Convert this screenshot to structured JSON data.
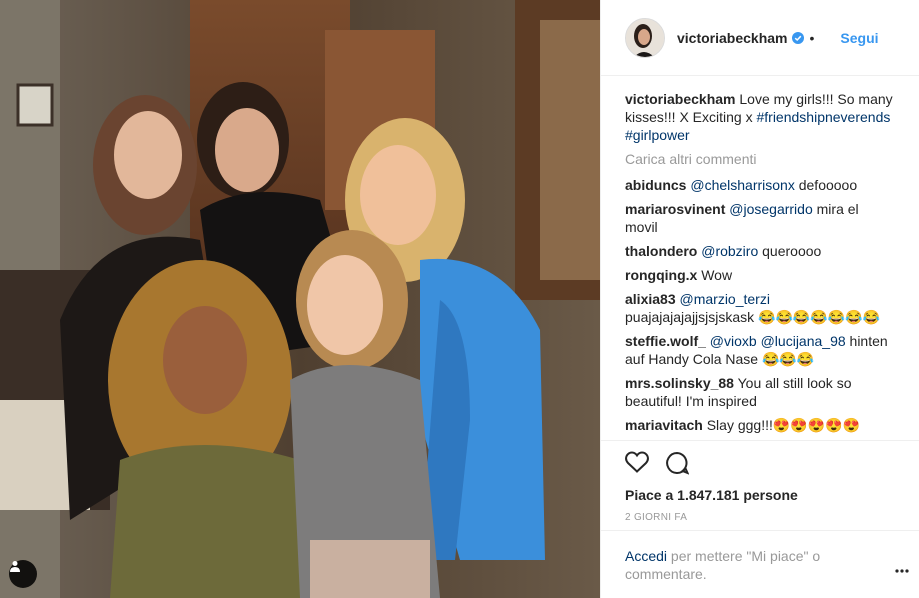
{
  "header": {
    "username": "victoriabeckham",
    "dot": "•",
    "follow_label": "Segui"
  },
  "caption": {
    "username": "victoriabeckham",
    "text": " Love my girls!!! So many kisses!!! X Exciting x ",
    "hashtags": [
      "#friendshipneverends",
      "#girlpower"
    ]
  },
  "load_more_label": "Carica altri commenti",
  "comments": [
    {
      "user": "abiduncs",
      "mentions": [
        "@chelsharrisonx"
      ],
      "text": " defooooo"
    },
    {
      "user": "mariarosvinent",
      "mentions": [
        "@josegarrido"
      ],
      "text": " mira el movil"
    },
    {
      "user": "thalondero",
      "mentions": [
        "@robziro"
      ],
      "text": " queroooo"
    },
    {
      "user": "rongqing.x",
      "mentions": [],
      "text": " Wow"
    },
    {
      "user": "alixia83",
      "mentions": [
        "@marzio_terzi"
      ],
      "text": " puajajajajajjsjsjskask 😂😂😂😂😂😂😂"
    },
    {
      "user": "steffie.wolf_",
      "mentions": [
        "@vioxb",
        "@lucijana_98"
      ],
      "text": " hinten auf Handy Cola Nase 😂😂😂"
    },
    {
      "user": "mrs.solinsky_88",
      "mentions": [],
      "text": " You all still look so beautiful! I'm inspired"
    },
    {
      "user": "mariavitach",
      "mentions": [],
      "text": " Slay ggg!!!😍😍😍😍😍"
    }
  ],
  "likes_text": "Piace a 1.847.181 persone",
  "date_text": "2 GIORNI FA",
  "login": {
    "link": "Accedi",
    "text": " per mettere \"Mi piace\" o commentare."
  },
  "icons": {
    "like": "heart-outline-icon",
    "comment": "comment-bubble-icon",
    "more": "more-dots-icon",
    "tag": "user-tag-icon",
    "verified": "verified-badge-icon"
  },
  "colors": {
    "follow": "#3897f0",
    "link": "#003569",
    "muted": "#999999",
    "text": "#262626"
  }
}
